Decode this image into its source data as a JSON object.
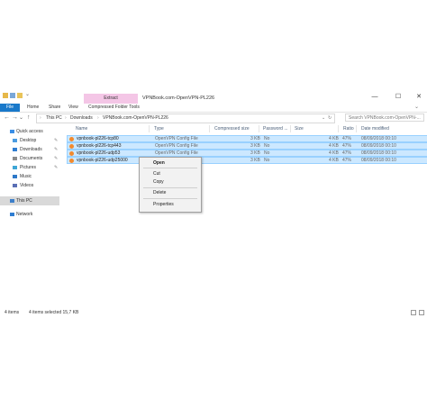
{
  "window": {
    "title": "VPNBook.com-OpenVPN-PL226",
    "context_tab": "Extract",
    "controls": {
      "minimize": "—",
      "maximize": "☐",
      "close": "✕"
    }
  },
  "ribbon": {
    "tabs": [
      "File",
      "Home",
      "Share",
      "View",
      "Compressed Folder Tools"
    ]
  },
  "address": {
    "crumbs": [
      "This PC",
      "Downloads",
      "VPNBook.com-OpenVPN-PL226"
    ],
    "search_placeholder": "Search VPNBook.com-OpenVPN-..."
  },
  "nav": {
    "items": [
      {
        "label": "Quick access",
        "icon": "star-icon"
      },
      {
        "label": "Desktop",
        "icon": "desktop-icon"
      },
      {
        "label": "Downloads",
        "icon": "download-icon"
      },
      {
        "label": "Documents",
        "icon": "document-icon"
      },
      {
        "label": "Pictures",
        "icon": "picture-icon"
      },
      {
        "label": "Music",
        "icon": "music-icon"
      },
      {
        "label": "Videos",
        "icon": "video-icon"
      },
      {
        "label": "This PC",
        "icon": "computer-icon"
      },
      {
        "label": "Network",
        "icon": "network-icon"
      }
    ]
  },
  "columns": [
    "Name",
    "Type",
    "Compressed size",
    "Password ...",
    "Size",
    "Ratio",
    "Date modified"
  ],
  "files": [
    {
      "name": "vpnbook-pl226-tcp80",
      "type": "OpenVPN Config File",
      "compressed": "3 KB",
      "password": "No",
      "size": "4 KB",
      "ratio": "47%",
      "date": "08/09/2018 00:10"
    },
    {
      "name": "vpnbook-pl226-tcp443",
      "type": "OpenVPN Config File",
      "compressed": "3 KB",
      "password": "No",
      "size": "4 KB",
      "ratio": "47%",
      "date": "08/09/2018 00:10"
    },
    {
      "name": "vpnbook-pl226-udp53",
      "type": "OpenVPN Config File",
      "compressed": "3 KB",
      "password": "No",
      "size": "4 KB",
      "ratio": "47%",
      "date": "08/09/2018 00:10"
    },
    {
      "name": "vpnbook-pl226-udp25000",
      "type": "OpenVPN Config File",
      "compressed": "3 KB",
      "password": "No",
      "size": "4 KB",
      "ratio": "47%",
      "date": "08/09/2018 00:10"
    }
  ],
  "context_menu": [
    "Open",
    "Cut",
    "Copy",
    "Delete",
    "Properties"
  ],
  "status": {
    "items": "4 items",
    "selected": "4 items selected  15,7 KB"
  },
  "colors": {
    "accent": "#1979ca",
    "selection": "#cce8ff",
    "context_tab": "#f4c6e6"
  }
}
